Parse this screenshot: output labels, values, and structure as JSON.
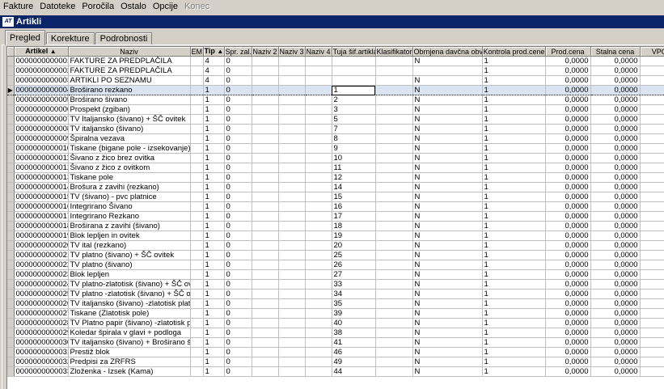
{
  "menu": [
    "Fakture",
    "Datoteke",
    "Poročila",
    "Ostalo",
    "Opcije",
    "Konec"
  ],
  "window": {
    "title": "Artikli",
    "icon_text": "AT"
  },
  "tabs": [
    "Pregled",
    "Korekture",
    "Podrobnosti"
  ],
  "columns": [
    {
      "label": "Artikel",
      "sort": "▲"
    },
    {
      "label": "Naziv"
    },
    {
      "label": "EM"
    },
    {
      "label": "Tip",
      "sort": "▲"
    },
    {
      "label": "Spr. zal."
    },
    {
      "label": "Naziv 2"
    },
    {
      "label": "Naziv 3"
    },
    {
      "label": "Naziv 4"
    },
    {
      "label": "Tuja šif.artikla"
    },
    {
      "label": "Klasifikator"
    },
    {
      "label": "Obrnjena davčna obv."
    },
    {
      "label": "Kontrola prod.cene"
    },
    {
      "label": "Prod.cena"
    },
    {
      "label": "Stalna cena"
    },
    {
      "label": "VPC"
    }
  ],
  "rows": [
    [
      "0000000000001",
      "FAKTURE ZA PREDPLAČILA",
      "",
      "4",
      "0",
      "",
      "",
      "",
      "",
      "",
      "N",
      "1",
      "0,0000",
      "0,0000",
      "0,0"
    ],
    [
      "0000000000002",
      "FAKTURE ZA PREDPLAČILA",
      "",
      "4",
      "0",
      "",
      "",
      "",
      "",
      "",
      "",
      "1",
      "0,0000",
      "0,0000",
      "0,0"
    ],
    [
      "0000000000003",
      "ARTIKLI PO SEZNAMU",
      "",
      "4",
      "0",
      "",
      "",
      "",
      "",
      "",
      "N",
      "1",
      "0,0000",
      "0,0000",
      "0,0"
    ],
    [
      "0000000000004",
      "Broširano rezkano",
      "",
      "1",
      "0",
      "",
      "",
      "",
      "1",
      "",
      "N",
      "1",
      "0,0000",
      "0,0000",
      "0,0"
    ],
    [
      "0000000000005",
      "Broširano šivano",
      "",
      "1",
      "0",
      "",
      "",
      "",
      "2",
      "",
      "N",
      "1",
      "0,0000",
      "0,0000",
      "0,0"
    ],
    [
      "0000000000006",
      "Prospekt (zgiban)",
      "",
      "1",
      "0",
      "",
      "",
      "",
      "3",
      "",
      "N",
      "1",
      "0,0000",
      "0,0000",
      "0,0"
    ],
    [
      "0000000000007",
      "TV Italjansko (šivano) + ŠČ ovitek",
      "",
      "1",
      "0",
      "",
      "",
      "",
      "5",
      "",
      "N",
      "1",
      "0,0000",
      "0,0000",
      "0,0"
    ],
    [
      "0000000000008",
      "TV italjansko (šivano)",
      "",
      "1",
      "0",
      "",
      "",
      "",
      "7",
      "",
      "N",
      "1",
      "0,0000",
      "0,0000",
      "0,0"
    ],
    [
      "0000000000009",
      "Špiralna vezava",
      "",
      "1",
      "0",
      "",
      "",
      "",
      "8",
      "",
      "N",
      "1",
      "0,0000",
      "0,0000",
      "0,0"
    ],
    [
      "0000000000010",
      "Tiskane (bigane pole - izsekovanje)",
      "",
      "1",
      "0",
      "",
      "",
      "",
      "9",
      "",
      "N",
      "1",
      "0,0000",
      "0,0000",
      "0,0"
    ],
    [
      "0000000000011",
      "Šivano z žico brez ovitka",
      "",
      "1",
      "0",
      "",
      "",
      "",
      "10",
      "",
      "N",
      "1",
      "0,0000",
      "0,0000",
      "0,0"
    ],
    [
      "0000000000012",
      "Šivano z žico z ovitkom",
      "",
      "1",
      "0",
      "",
      "",
      "",
      "11",
      "",
      "N",
      "1",
      "0,0000",
      "0,0000",
      "0,0"
    ],
    [
      "0000000000013",
      "Tiskane pole",
      "",
      "1",
      "0",
      "",
      "",
      "",
      "12",
      "",
      "N",
      "1",
      "0,0000",
      "0,0000",
      "0,0"
    ],
    [
      "0000000000014",
      "Brošura z zavihi (rezkano)",
      "",
      "1",
      "0",
      "",
      "",
      "",
      "14",
      "",
      "N",
      "1",
      "0,0000",
      "0,0000",
      "0,0"
    ],
    [
      "0000000000015",
      "TV (šivano) - pvc platnice",
      "",
      "1",
      "0",
      "",
      "",
      "",
      "15",
      "",
      "N",
      "1",
      "0,0000",
      "0,0000",
      "0,0"
    ],
    [
      "0000000000016",
      "Integrirano Šivano",
      "",
      "1",
      "0",
      "",
      "",
      "",
      "16",
      "",
      "N",
      "1",
      "0,0000",
      "0,0000",
      "0,0"
    ],
    [
      "0000000000017",
      "Integrirano Rezkano",
      "",
      "1",
      "0",
      "",
      "",
      "",
      "17",
      "",
      "N",
      "1",
      "0,0000",
      "0,0000",
      "0,0"
    ],
    [
      "0000000000018",
      "Broširana z zavihi (šivano)",
      "",
      "1",
      "0",
      "",
      "",
      "",
      "18",
      "",
      "N",
      "1",
      "0,0000",
      "0,0000",
      "0,0"
    ],
    [
      "0000000000019",
      "Blok lepljen in ovitek",
      "",
      "1",
      "0",
      "",
      "",
      "",
      "19",
      "",
      "N",
      "1",
      "0,0000",
      "0,0000",
      "0,0"
    ],
    [
      "0000000000020",
      "TV ital (rezkano)",
      "",
      "1",
      "0",
      "",
      "",
      "",
      "20",
      "",
      "N",
      "1",
      "0,0000",
      "0,0000",
      "0,0"
    ],
    [
      "0000000000021",
      "TV platno (šivano) + ŠČ ovitek",
      "",
      "1",
      "0",
      "",
      "",
      "",
      "25",
      "",
      "N",
      "1",
      "0,0000",
      "0,0000",
      "0,0"
    ],
    [
      "0000000000022",
      "TV platno (šivano)",
      "",
      "1",
      "0",
      "",
      "",
      "",
      "26",
      "",
      "N",
      "1",
      "0,0000",
      "0,0000",
      "0,0"
    ],
    [
      "0000000000023",
      "Blok lepljen",
      "",
      "1",
      "0",
      "",
      "",
      "",
      "27",
      "",
      "N",
      "1",
      "0,0000",
      "0,0000",
      "0,0"
    ],
    [
      "0000000000024",
      "TV platno-zlatotisk (šivano) + ŠČ ovitek",
      "",
      "1",
      "0",
      "",
      "",
      "",
      "33",
      "",
      "N",
      "1",
      "0,0000",
      "0,0000",
      "0,0"
    ],
    [
      "0000000000025",
      "TV platno -zlatotisk (šivano) + ŠČ ovite",
      "",
      "1",
      "0",
      "",
      "",
      "",
      "34",
      "",
      "N",
      "1",
      "0,0000",
      "0,0000",
      "0,0"
    ],
    [
      "0000000000026",
      "TV italjansko (šivano) -zlatotisk platni",
      "",
      "1",
      "0",
      "",
      "",
      "",
      "35",
      "",
      "N",
      "1",
      "0,0000",
      "0,0000",
      "0,0"
    ],
    [
      "0000000000027",
      "Tiskane (Zlatotisk pole)",
      "",
      "1",
      "0",
      "",
      "",
      "",
      "39",
      "",
      "N",
      "1",
      "0,0000",
      "0,0000",
      "0,0"
    ],
    [
      "0000000000028",
      "TV Platno papir (šivano) -zlatotisk pl",
      "",
      "1",
      "0",
      "",
      "",
      "",
      "40",
      "",
      "N",
      "1",
      "0,0000",
      "0,0000",
      "0,0"
    ],
    [
      "0000000000029",
      "Koledar špirala v glavi + podloga",
      "",
      "1",
      "0",
      "",
      "",
      "",
      "38",
      "",
      "N",
      "1",
      "0,0000",
      "0,0000",
      "0,0"
    ],
    [
      "0000000000030",
      "TV italjansko (šivano) + Broširano šivan",
      "",
      "1",
      "0",
      "",
      "",
      "",
      "41",
      "",
      "N",
      "1",
      "0,0000",
      "0,0000",
      "0,0"
    ],
    [
      "0000000000031",
      "Prestiž blok",
      "",
      "1",
      "0",
      "",
      "",
      "",
      "46",
      "",
      "N",
      "1",
      "0,0000",
      "0,0000",
      "0,0"
    ],
    [
      "0000000000032",
      "Predpisi za ZRFRS",
      "",
      "1",
      "0",
      "",
      "",
      "",
      "49",
      "",
      "N",
      "1",
      "0,0000",
      "0,0000",
      "0,0"
    ],
    [
      "0000000000033",
      "Zloženka - Izsek (Kama)",
      "",
      "1",
      "0",
      "",
      "",
      "",
      "44",
      "",
      "N",
      "1",
      "0,0000",
      "0,0000",
      "0,0"
    ]
  ],
  "selected_row": 3,
  "row_indicator": "▶",
  "colors": {
    "titlebar": "#0a246a",
    "selection": "#dbe4f3",
    "chrome": "#d4d0c8"
  }
}
